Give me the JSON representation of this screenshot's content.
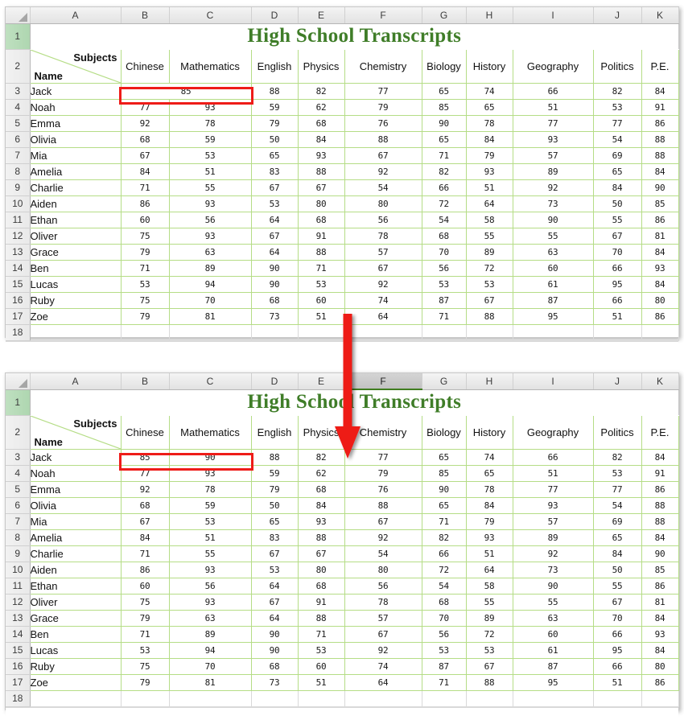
{
  "spreadsheet": {
    "column_headers": [
      "A",
      "B",
      "C",
      "D",
      "E",
      "F",
      "G",
      "H",
      "I",
      "J",
      "K"
    ],
    "row_numbers": [
      "1",
      "2",
      "3",
      "4",
      "5",
      "6",
      "7",
      "8",
      "9",
      "10",
      "11",
      "12",
      "13",
      "14",
      "15",
      "16",
      "17",
      "18"
    ],
    "title": "High School Transcripts",
    "title_color": "#3f7d28",
    "corner_label_top": "Subjects",
    "corner_label_bottom": "Name",
    "subject_headers": [
      "Chinese",
      "Mathematics",
      "English",
      "Physics",
      "Chemistry",
      "Biology",
      "History",
      "Geography",
      "Politics",
      "P.E."
    ],
    "students": [
      {
        "name": "Jack",
        "scores": [
          "85",
          "90",
          "88",
          "82",
          "77",
          "65",
          "74",
          "66",
          "82",
          "84"
        ]
      },
      {
        "name": "Noah",
        "scores": [
          "77",
          "93",
          "59",
          "62",
          "79",
          "85",
          "65",
          "51",
          "53",
          "91"
        ]
      },
      {
        "name": "Emma",
        "scores": [
          "92",
          "78",
          "79",
          "68",
          "76",
          "90",
          "78",
          "77",
          "77",
          "86"
        ]
      },
      {
        "name": "Olivia",
        "scores": [
          "68",
          "59",
          "50",
          "84",
          "88",
          "65",
          "84",
          "93",
          "54",
          "88"
        ]
      },
      {
        "name": "Mia",
        "scores": [
          "67",
          "53",
          "65",
          "93",
          "67",
          "71",
          "79",
          "57",
          "69",
          "88"
        ]
      },
      {
        "name": "Amelia",
        "scores": [
          "84",
          "51",
          "83",
          "88",
          "92",
          "82",
          "93",
          "89",
          "65",
          "84"
        ]
      },
      {
        "name": "Charlie",
        "scores": [
          "71",
          "55",
          "67",
          "67",
          "54",
          "66",
          "51",
          "92",
          "84",
          "90"
        ]
      },
      {
        "name": "Aiden",
        "scores": [
          "86",
          "93",
          "53",
          "80",
          "80",
          "72",
          "64",
          "73",
          "50",
          "85"
        ]
      },
      {
        "name": "Ethan",
        "scores": [
          "60",
          "56",
          "64",
          "68",
          "56",
          "54",
          "58",
          "90",
          "55",
          "86"
        ]
      },
      {
        "name": "Oliver",
        "scores": [
          "75",
          "93",
          "67",
          "91",
          "78",
          "68",
          "55",
          "55",
          "67",
          "81"
        ]
      },
      {
        "name": "Grace",
        "scores": [
          "79",
          "63",
          "64",
          "88",
          "57",
          "70",
          "89",
          "63",
          "70",
          "84"
        ]
      },
      {
        "name": "Ben",
        "scores": [
          "71",
          "89",
          "90",
          "71",
          "67",
          "56",
          "72",
          "60",
          "66",
          "93"
        ]
      },
      {
        "name": "Lucas",
        "scores": [
          "53",
          "94",
          "90",
          "53",
          "92",
          "53",
          "53",
          "61",
          "95",
          "84"
        ]
      },
      {
        "name": "Ruby",
        "scores": [
          "75",
          "70",
          "68",
          "60",
          "74",
          "87",
          "67",
          "87",
          "66",
          "80"
        ]
      },
      {
        "name": "Zoe",
        "scores": [
          "79",
          "81",
          "73",
          "51",
          "64",
          "71",
          "88",
          "95",
          "51",
          "86"
        ]
      }
    ]
  },
  "top_sheet": {
    "merged_first_row": true,
    "merged_value": "85",
    "selected_column": null,
    "highlight_note": "B3:C3 merged, value 85 centered"
  },
  "bottom_sheet": {
    "merged_first_row": false,
    "first_row_values": [
      "85",
      "90"
    ],
    "selected_column": "F",
    "highlight_note": "B3 and C3 unmerged, values 85 and 90"
  },
  "annotation": {
    "arrow_color": "#ee1c18",
    "box_color": "#ee1c18",
    "arrow_name": "down-arrow"
  }
}
